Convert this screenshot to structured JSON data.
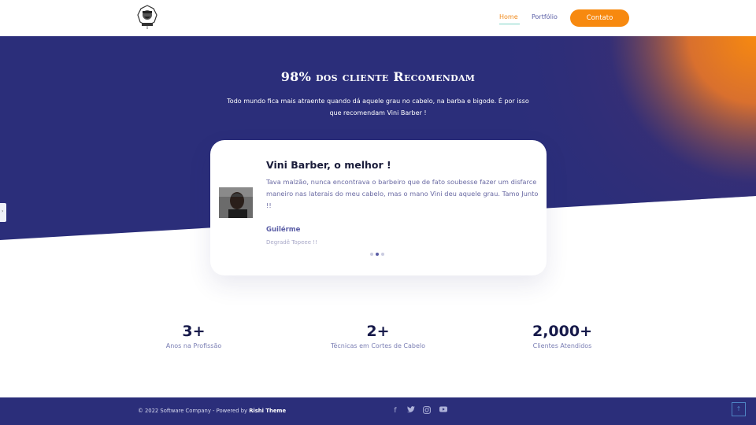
{
  "header": {
    "nav": {
      "home": "Home",
      "portfolio": "Portfólio"
    },
    "cta_label": "Contato",
    "logo_text": "BARBER"
  },
  "hero": {
    "title": "98% dos cliente Recomendam",
    "subtitle": "Todo mundo fica mais atraente quando dá aquele grau no cabelo, na barba e bigode. É por isso que recomendam Vini Barber !"
  },
  "testimonial": {
    "title": "Vini Barber, o melhor !",
    "text": "Tava malzão, nunca encontrava o barbeiro que de fato soubesse fazer um disfarce maneiro nas laterais do meu cabelo, mas o mano Vini deu aquele grau. Tamo Junto !!",
    "author": "Guilérme",
    "role": "Degradê Topeee !!",
    "slides": 3,
    "active_slide": 2
  },
  "stats": [
    {
      "value": "3+",
      "label": "Anos na Profissão"
    },
    {
      "value": "2+",
      "label": "Técnicas em Cortes de Cabelo"
    },
    {
      "value": "2,000+",
      "label": "Clientes Atendidos"
    }
  ],
  "footer": {
    "copyright": "© 2022 Software Company - Powered by ",
    "theme": "Rishi Theme",
    "social": [
      "facebook-icon",
      "twitter-icon",
      "instagram-icon",
      "youtube-icon"
    ]
  },
  "colors": {
    "primary": "#2b2e7a",
    "accent": "#f7890f",
    "text_dark": "#171a4a"
  }
}
